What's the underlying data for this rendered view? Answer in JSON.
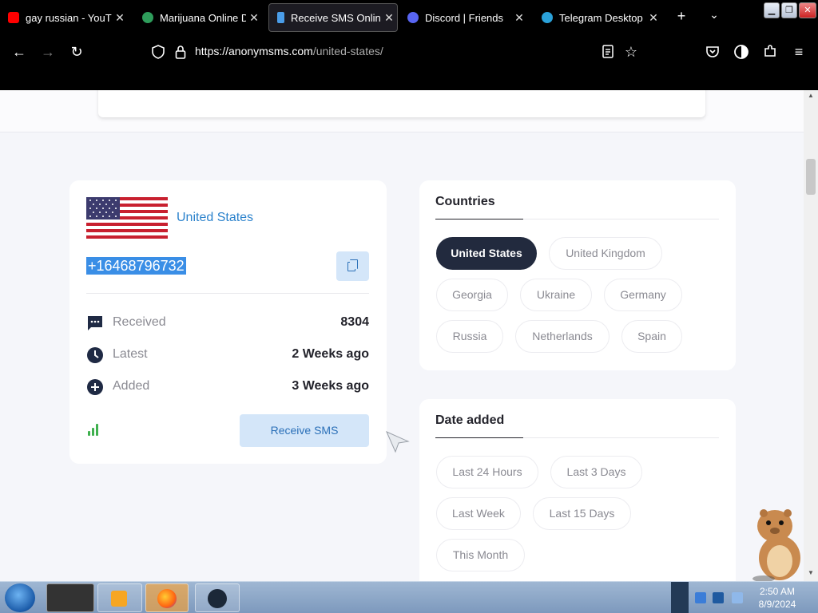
{
  "browser": {
    "tabs": [
      {
        "title": "gay russian - YouTube",
        "favicon": "youtube-icon",
        "color": "#ff0000"
      },
      {
        "title": "Marijuana Online Dispensary",
        "favicon": "globe-icon",
        "color": "#2e9d5b"
      },
      {
        "title": "Receive SMS Online",
        "favicon": "phone-icon",
        "color": "#4a9de8",
        "active": true
      },
      {
        "title": "Discord | Friends",
        "favicon": "discord-icon",
        "color": "#5865f2"
      },
      {
        "title": "Telegram Desktop",
        "favicon": "telegram-icon",
        "color": "#2aa1d9"
      }
    ],
    "url_host": "https://anonymsms.com",
    "url_path": "/united-states/"
  },
  "number_card": {
    "country": "United States",
    "phone": "+16468796732",
    "stats": [
      {
        "icon": "message-icon",
        "label": "Received",
        "value": "8304"
      },
      {
        "icon": "clock-icon",
        "label": "Latest",
        "value": "2 Weeks ago"
      },
      {
        "icon": "plus-circle-icon",
        "label": "Added",
        "value": "3 Weeks ago"
      }
    ],
    "receive_label": "Receive SMS"
  },
  "countries": {
    "title": "Countries",
    "items": [
      "United States",
      "United Kingdom",
      "Georgia",
      "Ukraine",
      "Germany",
      "Russia",
      "Netherlands",
      "Spain"
    ],
    "selected": "United States"
  },
  "date_added": {
    "title": "Date added",
    "items": [
      "Last 24 Hours",
      "Last 3 Days",
      "Last Week",
      "Last 15 Days",
      "This Month"
    ]
  },
  "taskbar": {
    "time": "2:50 AM",
    "date": "8/9/2024"
  },
  "colors": {
    "accent": "#2b82cc",
    "dark_chip": "#222a3e",
    "signal": "#3fb04e"
  }
}
